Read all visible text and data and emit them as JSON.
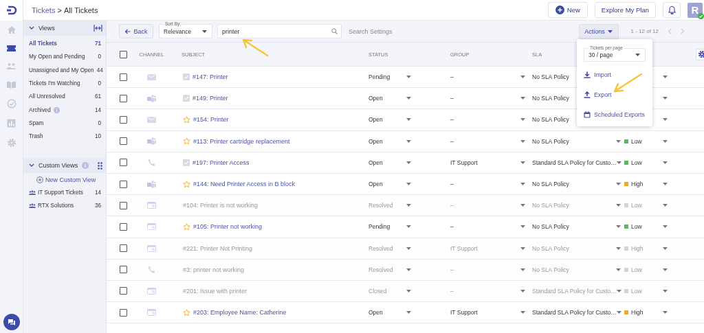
{
  "breadcrumb": {
    "parent": "Tickets",
    "separator": ">",
    "current": "All Tickets"
  },
  "header": {
    "new_label": "New",
    "plan_label": "Explore My Plan",
    "avatar": "R"
  },
  "views": {
    "title": "Views",
    "items": [
      {
        "label": "All Tickets",
        "count": "71",
        "selected": true,
        "info": false
      },
      {
        "label": "My Open and Pending",
        "count": "0",
        "selected": false,
        "info": false
      },
      {
        "label": "Unassigned and My Open",
        "count": "44",
        "selected": false,
        "info": false
      },
      {
        "label": "Tickets I'm Watching",
        "count": "0",
        "selected": false,
        "info": false
      },
      {
        "label": "All Unresolved",
        "count": "61",
        "selected": false,
        "info": false
      },
      {
        "label": "Archived",
        "count": "14",
        "selected": false,
        "info": true
      },
      {
        "label": "Spam",
        "count": "0",
        "selected": false,
        "info": false
      },
      {
        "label": "Trash",
        "count": "10",
        "selected": false,
        "info": false
      }
    ]
  },
  "custom_views": {
    "title": "Custom Views",
    "new_label": "New Custom View",
    "items": [
      {
        "label": "IT Support Tickets",
        "count": "14"
      },
      {
        "label": "RTX Solutions",
        "count": "36"
      }
    ]
  },
  "toolbar": {
    "back": "Back",
    "sort": {
      "label": "Sort By:",
      "value": "Relevance"
    },
    "search": {
      "value": "printer"
    },
    "search_settings": "Search Settings",
    "actions": "Actions",
    "pagination": "1 - 12 of 12"
  },
  "actions_menu": {
    "per_page": {
      "label": "Tickets per page",
      "value": "30 / page"
    },
    "items": [
      {
        "kind": "import",
        "label": "Import"
      },
      {
        "kind": "export",
        "label": "Export"
      },
      {
        "kind": "schedule",
        "label": "Scheduled Exports"
      }
    ]
  },
  "table": {
    "select_all": {
      "checked": false
    },
    "columns": [
      "CHANNEL",
      "SUBJECT",
      "STATUS",
      "GROUP",
      "SLA"
    ],
    "rows": [
      {
        "checked": false,
        "channel": {
          "kind": "email"
        },
        "flag": {
          "kind": "check"
        },
        "subject": "#147: Printer",
        "status": "Pending",
        "group": "–",
        "sla": "No SLA Policy",
        "muted": false
      },
      {
        "checked": false,
        "channel": {
          "kind": "teams"
        },
        "flag": {
          "kind": "check"
        },
        "subject": "#149: Printer",
        "status": "Open",
        "group": "–",
        "sla": "No SLA Policy",
        "muted": false
      },
      {
        "checked": false,
        "channel": {
          "kind": "email"
        },
        "flag": {
          "kind": "star"
        },
        "subject": "#154: Printer",
        "status": "Open",
        "group": "–",
        "sla": "No SLA Policy",
        "muted": false
      },
      {
        "checked": false,
        "channel": {
          "kind": "teams"
        },
        "flag": {
          "kind": "star"
        },
        "subject": "#113: Printer cartridge replacement",
        "status": "Open",
        "group": "–",
        "sla": "No SLA Policy",
        "priority": {
          "label": "Low",
          "color": "#5cb85c"
        },
        "muted": false
      },
      {
        "checked": false,
        "channel": {
          "kind": "phone"
        },
        "flag": {
          "kind": "check"
        },
        "subject": "#197: Printer Access",
        "status": "Open",
        "group": "IT Support",
        "sla": "Standard SLA Policy for Custo…",
        "priority": {
          "label": "Low",
          "color": "#5cb85c"
        },
        "muted": false
      },
      {
        "checked": false,
        "channel": {
          "kind": "teams"
        },
        "flag": {
          "kind": "star"
        },
        "subject": "#144: Need Printer Access in B block",
        "status": "Open",
        "group": "–",
        "sla": "No SLA Policy",
        "priority": {
          "label": "High",
          "color": "#f5a623"
        },
        "muted": false
      },
      {
        "checked": false,
        "channel": {
          "kind": "portal"
        },
        "subject": "#104: Printer is not working",
        "status": "Resolved",
        "group": "–",
        "sla": "No SLA Policy",
        "priority": {
          "label": "Low",
          "color": "#d4d4d4"
        },
        "muted": true
      },
      {
        "checked": false,
        "channel": {
          "kind": "portal"
        },
        "flag": {
          "kind": "star"
        },
        "subject": "#105: Printer not working",
        "status": "Pending",
        "group": "–",
        "sla": "No SLA Policy",
        "priority": {
          "label": "Low",
          "color": "#5cb85c"
        },
        "muted": false
      },
      {
        "checked": false,
        "channel": {
          "kind": "portal"
        },
        "subject": "#221: Printer Not Printing",
        "status": "Resolved",
        "group": "IT Support",
        "sla": "No SLA Policy",
        "priority": {
          "label": "High",
          "color": "#d4d4d4"
        },
        "muted": true
      },
      {
        "checked": false,
        "channel": {
          "kind": "phone"
        },
        "subject": "#3: printer not working",
        "status": "Resolved",
        "group": "–",
        "sla": "No SLA Policy",
        "priority": {
          "label": "Low",
          "color": "#d4d4d4"
        },
        "muted": true
      },
      {
        "checked": false,
        "channel": {
          "kind": "portal"
        },
        "subject": "#201: Issue with printer",
        "status": "Closed",
        "group": "–",
        "sla": "Standard SLA Policy for Custo…",
        "priority": {
          "label": "Low",
          "color": "#d4d4d4"
        },
        "muted": true
      },
      {
        "checked": false,
        "channel": {
          "kind": "portal"
        },
        "flag": {
          "kind": "star"
        },
        "subject": "#203: Employee Name: Catherine",
        "status": "Open",
        "group": "IT Support",
        "sla": "Standard SLA Policy for Custo…",
        "priority": {
          "label": "High",
          "color": "#f5a623"
        },
        "muted": false
      }
    ]
  }
}
